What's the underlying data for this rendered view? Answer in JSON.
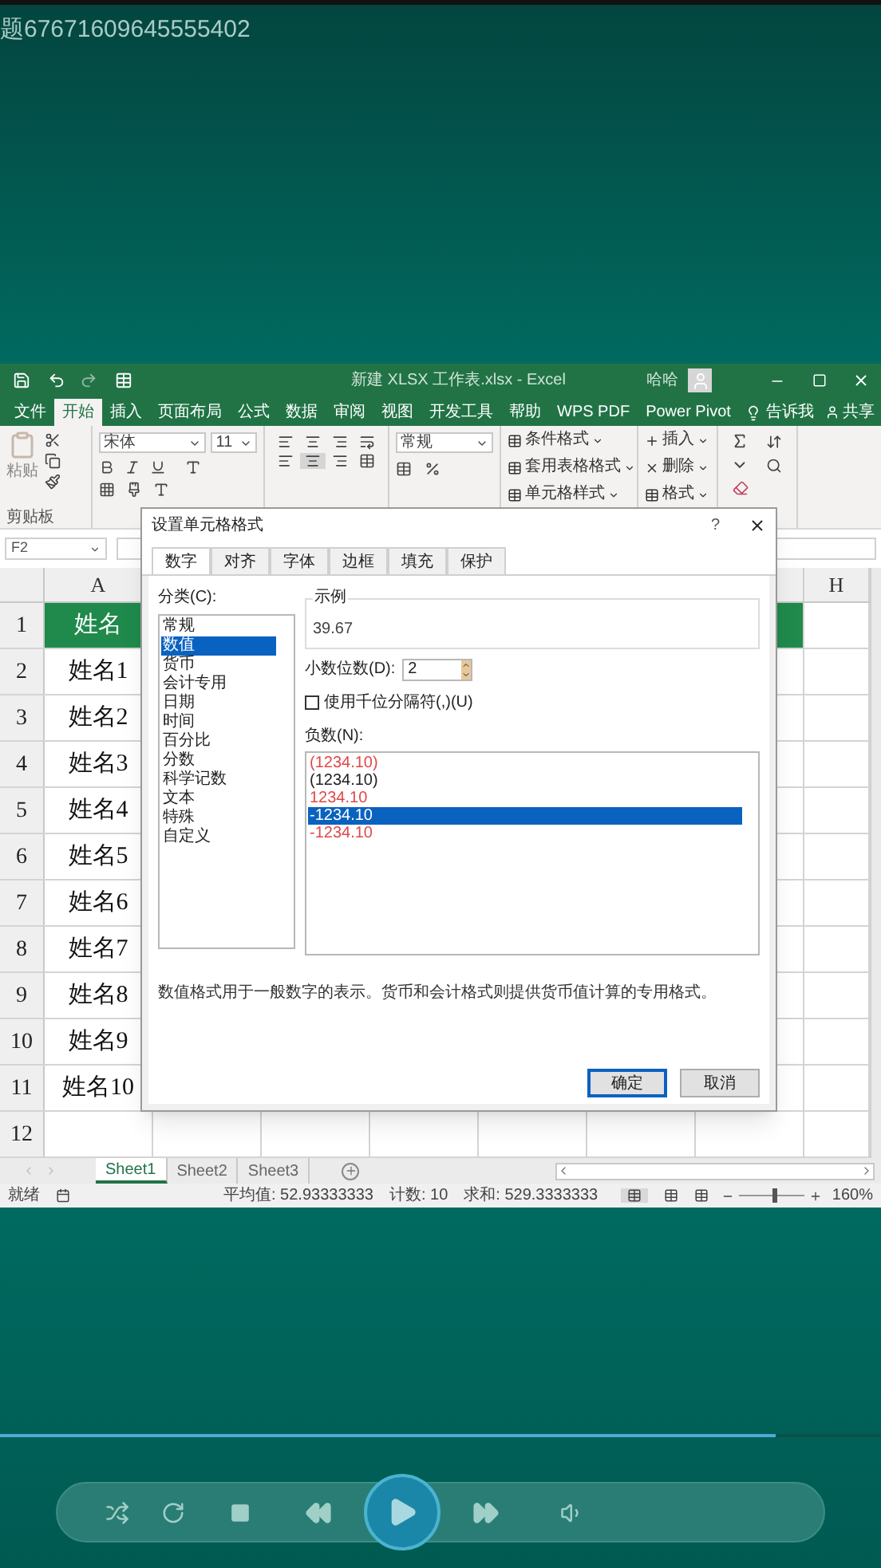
{
  "video_title": "题67671609645555402",
  "excel": {
    "title": "新建 XLSX 工作表.xlsx - Excel",
    "user": "哈哈",
    "ribbon_tabs": [
      {
        "label": "文件",
        "selected": false
      },
      {
        "label": "开始",
        "selected": true
      },
      {
        "label": "插入",
        "selected": false
      },
      {
        "label": "页面布局",
        "selected": false
      },
      {
        "label": "公式",
        "selected": false
      },
      {
        "label": "数据",
        "selected": false
      },
      {
        "label": "审阅",
        "selected": false
      },
      {
        "label": "视图",
        "selected": false
      },
      {
        "label": "开发工具",
        "selected": false
      },
      {
        "label": "帮助",
        "selected": false
      },
      {
        "label": "WPS PDF",
        "selected": false
      },
      {
        "label": "Power Pivot",
        "selected": false
      }
    ],
    "tell_me": "告诉我",
    "share": "共享",
    "ribbon": {
      "paste": "粘贴",
      "clipboard_group": "剪贴板",
      "font_name": "宋体",
      "font_size": "11",
      "number_format": "常规",
      "conditional_format": "条件格式",
      "format_as_table": "套用表格格式",
      "cell_styles": "单元格样式",
      "insert": "插入",
      "delete": "删除",
      "format": "格式"
    },
    "name_box": "F2",
    "columns": [
      "A",
      "H"
    ],
    "rows": [
      {
        "number": "1",
        "cell_a": "姓名",
        "kind": "header"
      },
      {
        "number": "2",
        "cell_a": "姓名1",
        "kind": "data"
      },
      {
        "number": "3",
        "cell_a": "姓名2",
        "kind": "data"
      },
      {
        "number": "4",
        "cell_a": "姓名3",
        "kind": "data"
      },
      {
        "number": "5",
        "cell_a": "姓名4",
        "kind": "data"
      },
      {
        "number": "6",
        "cell_a": "姓名5",
        "kind": "data"
      },
      {
        "number": "7",
        "cell_a": "姓名6",
        "kind": "data"
      },
      {
        "number": "8",
        "cell_a": "姓名7",
        "kind": "data"
      },
      {
        "number": "9",
        "cell_a": "姓名8",
        "kind": "data"
      },
      {
        "number": "10",
        "cell_a": "姓名9",
        "kind": "data"
      },
      {
        "number": "11",
        "cell_a": "姓名10",
        "kind": "data"
      },
      {
        "number": "12",
        "kind": "data"
      }
    ],
    "sheet_tabs": [
      {
        "label": "Sheet1",
        "selected": true
      },
      {
        "label": "Sheet2",
        "selected": false
      },
      {
        "label": "Sheet3",
        "selected": false
      }
    ],
    "status": {
      "ready": "就绪",
      "average": "平均值: 52.93333333",
      "count": "计数: 10",
      "sum": "求和: 529.3333333",
      "zoom": "160%",
      "zoom_slider": {
        "level": 0.5
      }
    }
  },
  "dialog": {
    "title": "设置单元格格式",
    "help": "?",
    "tabs": [
      {
        "label": "数字",
        "selected": true
      },
      {
        "label": "对齐",
        "selected": false
      },
      {
        "label": "字体",
        "selected": false
      },
      {
        "label": "边框",
        "selected": false
      },
      {
        "label": "填充",
        "selected": false
      },
      {
        "label": "保护",
        "selected": false
      }
    ],
    "category_label": "分类(C):",
    "categories": [
      {
        "label": "常规",
        "selected": false
      },
      {
        "label": "数值",
        "selected": true
      },
      {
        "label": "货币",
        "selected": false
      },
      {
        "label": "会计专用",
        "selected": false
      },
      {
        "label": "日期",
        "selected": false
      },
      {
        "label": "时间",
        "selected": false
      },
      {
        "label": "百分比",
        "selected": false
      },
      {
        "label": "分数",
        "selected": false
      },
      {
        "label": "科学记数",
        "selected": false
      },
      {
        "label": "文本",
        "selected": false
      },
      {
        "label": "特殊",
        "selected": false
      },
      {
        "label": "自定义",
        "selected": false
      }
    ],
    "sample_label": "示例",
    "sample_value": "39.67",
    "decimal_label": "小数位数(D):",
    "decimal_value": "2",
    "thousands": {
      "label": "使用千位分隔符(,)(U)",
      "checked": false
    },
    "negative_label": "负数(N):",
    "negatives": [
      {
        "label": "(1234.10)",
        "color": "#e04848",
        "selected": false
      },
      {
        "label": "(1234.10)",
        "color": "#222222",
        "selected": false
      },
      {
        "label": "1234.10",
        "color": "#e04848",
        "selected": false
      },
      {
        "label": "-1234.10",
        "selected": true
      },
      {
        "label": "-1234.10",
        "color": "#e04848",
        "selected": false
      }
    ],
    "description": "数值格式用于一般数字的表示。货币和会计格式则提供货币值计算的专用格式。",
    "buttons": [
      {
        "label": "确定",
        "kind": "primary"
      },
      {
        "label": "取消",
        "kind": "secondary"
      }
    ]
  },
  "player": {
    "progress": {
      "level": 0.88
    }
  }
}
